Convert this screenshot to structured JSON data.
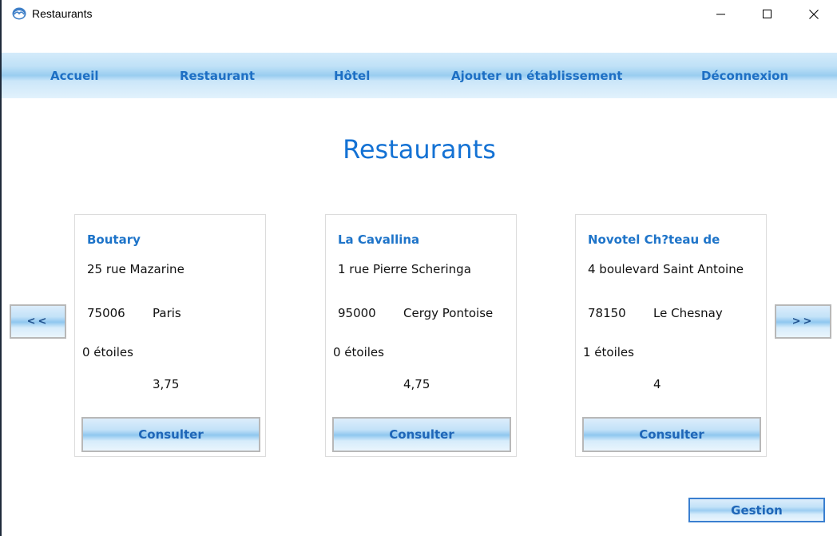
{
  "window": {
    "title": "Restaurants",
    "icon": "app-logo-icon"
  },
  "nav": {
    "items": [
      {
        "label": "Accueil"
      },
      {
        "label": "Restaurant"
      },
      {
        "label": "Hôtel"
      },
      {
        "label": "Ajouter un établissement"
      },
      {
        "label": "Déconnexion"
      }
    ]
  },
  "page": {
    "title": "Restaurants"
  },
  "cards": [
    {
      "name": "Boutary",
      "address": "25 rue Mazarine",
      "zip": "75006",
      "city": "Paris",
      "stars": "0 étoiles",
      "rating": "3,75",
      "button": "Consulter"
    },
    {
      "name": "La Cavallina",
      "address": "1 rue Pierre Scheringa",
      "zip": "95000",
      "city": "Cergy Pontoise",
      "stars": "0 étoiles",
      "rating": "4,75",
      "button": "Consulter"
    },
    {
      "name": "Novotel Ch?teau de",
      "address": "4 boulevard Saint Antoine",
      "zip": "78150",
      "city": "Le Chesnay",
      "stars": "1 étoiles",
      "rating": "4",
      "button": "Consulter"
    }
  ],
  "pager": {
    "prev": "<<",
    "next": ">>"
  },
  "footer": {
    "gestion": "Gestion"
  },
  "colors": {
    "accent": "#1472d4",
    "nav_text": "#1d6fc4"
  }
}
